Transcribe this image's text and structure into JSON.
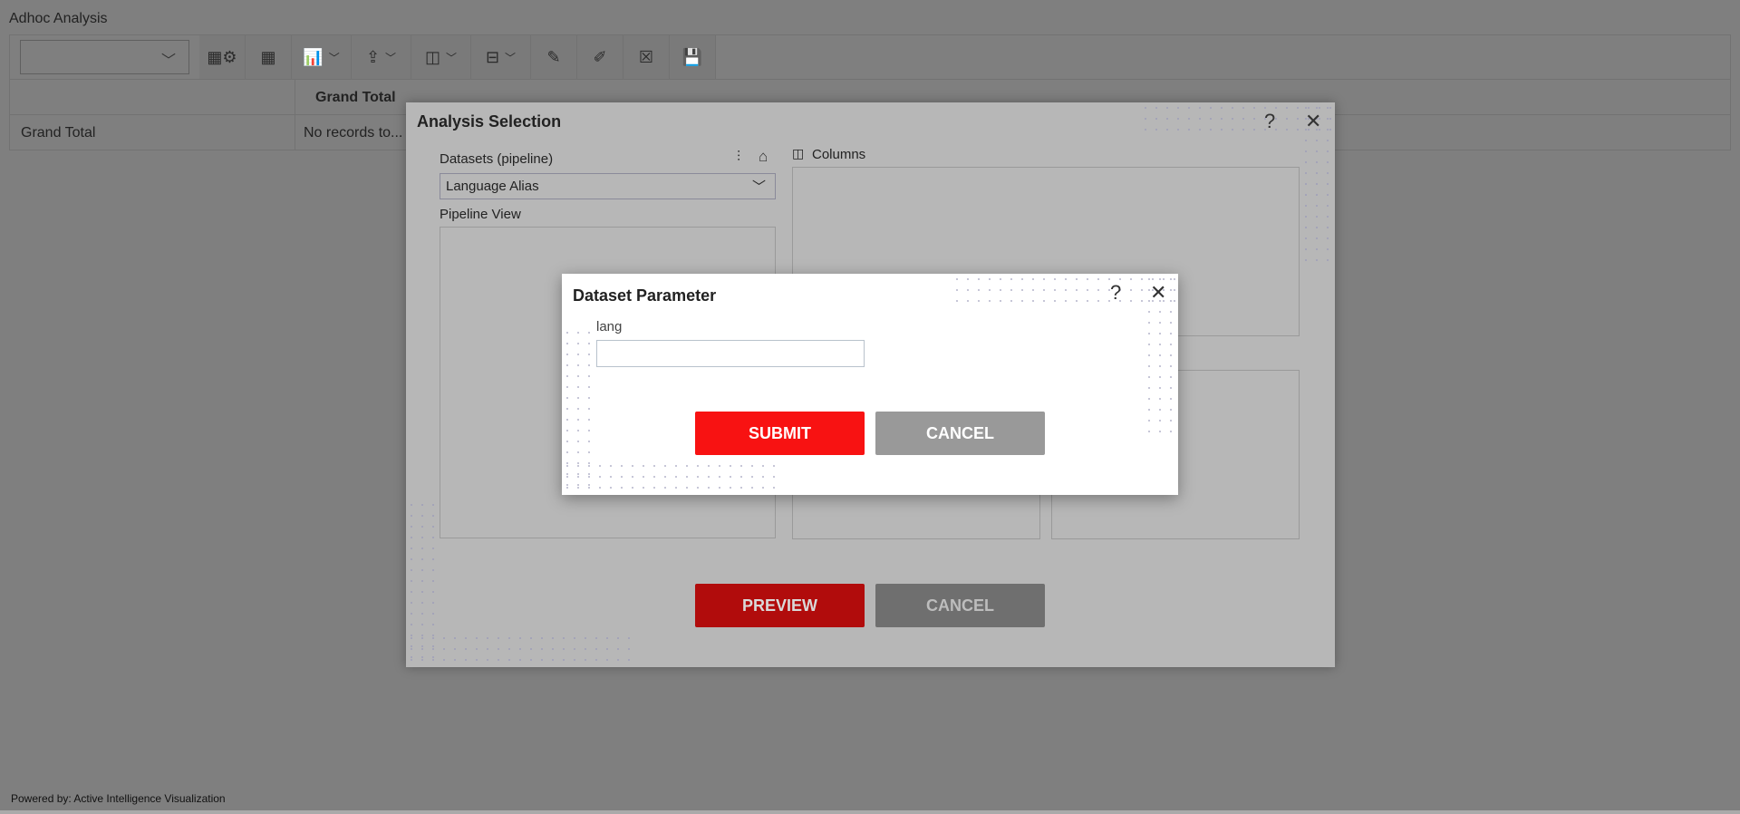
{
  "app": {
    "title": "Adhoc Analysis",
    "footer": "Powered by: Active Intelligence Visualization"
  },
  "toolbar": {
    "buttons": [
      {
        "name": "grid-settings-icon",
        "glyph": "▦⚙",
        "dropdown": false
      },
      {
        "name": "table-icon",
        "glyph": "▦",
        "dropdown": false
      },
      {
        "name": "chart-icon",
        "glyph": "📊",
        "dropdown": true
      },
      {
        "name": "export-icon",
        "glyph": "⇪",
        "dropdown": true
      },
      {
        "name": "column-layout-icon",
        "glyph": "◫",
        "dropdown": true
      },
      {
        "name": "row-layout-icon",
        "glyph": "⊟",
        "dropdown": true
      },
      {
        "name": "edit-script-icon",
        "glyph": "✎",
        "dropdown": false
      },
      {
        "name": "edit-number-icon",
        "glyph": "✐",
        "dropdown": false
      },
      {
        "name": "excel-icon",
        "glyph": "☒",
        "dropdown": false
      },
      {
        "name": "save-icon",
        "glyph": "💾",
        "dropdown": false
      }
    ]
  },
  "table": {
    "column_header": "Grand Total",
    "row_label": "Grand Total",
    "cell_value": "No records to..."
  },
  "analysis_dialog": {
    "title": "Analysis Selection",
    "datasets_label": "Datasets (pipeline)",
    "dataset_selected": "Language Alias",
    "pipeline_view_label": "Pipeline View",
    "columns_label": "Columns",
    "preview_label": "PREVIEW",
    "cancel_label": "CANCEL",
    "help": "?",
    "close": "✕"
  },
  "param_dialog": {
    "title": "Dataset Parameter",
    "field_label": "lang",
    "field_value": "",
    "submit_label": "SUBMIT",
    "cancel_label": "CANCEL",
    "help": "?",
    "close": "✕"
  },
  "colors": {
    "submit": "#f81212",
    "preview": "#b10c0c",
    "cancel": "#999999",
    "cancel_dim": "#6f6f6f"
  }
}
